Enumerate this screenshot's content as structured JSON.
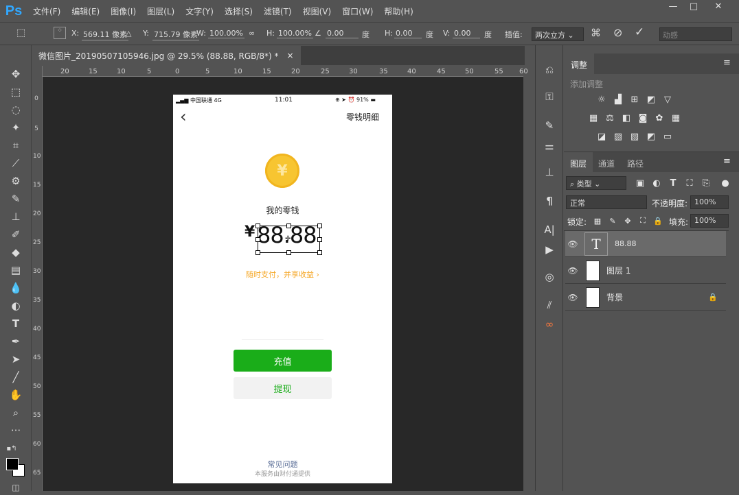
{
  "app": {
    "logo": "Ps"
  },
  "menu": [
    "文件(F)",
    "编辑(E)",
    "图像(I)",
    "图层(L)",
    "文字(Y)",
    "选择(S)",
    "滤镜(T)",
    "视图(V)",
    "窗口(W)",
    "帮助(H)"
  ],
  "window_controls": {
    "minimize": "—",
    "maximize": "□",
    "close": "✕"
  },
  "options": {
    "x_label": "X:",
    "x_value": "569.11 像素",
    "y_label": "Y:",
    "y_value": "715.79 像素",
    "w_label": "W:",
    "w_value": "100.00%",
    "h_label": "H:",
    "h_value": "100.00%",
    "angle_value": "0.00",
    "angle_unit": "度",
    "h_skew_label": "H:",
    "h_skew_value": "0.00",
    "h_skew_unit": "度",
    "v_skew_label": "V:",
    "v_skew_value": "0.00",
    "v_skew_unit": "度",
    "interp_label": "插值:",
    "interp_value": "两次立方",
    "warp_label": "动感"
  },
  "document_tab": {
    "title": "微信图片_20190507105946.jpg @ 29.5% (88.88, RGB/8*) *",
    "close": "×"
  },
  "hruler": [
    "20",
    "15",
    "10",
    "5",
    "0",
    "5",
    "10",
    "15",
    "20",
    "25",
    "30",
    "35",
    "40",
    "45",
    "50",
    "55",
    "60"
  ],
  "vruler": [
    "0",
    "5",
    "10",
    "15",
    "20",
    "25",
    "30",
    "35",
    "40",
    "45",
    "50",
    "55",
    "60",
    "65"
  ],
  "phone": {
    "carrier": "中国联通",
    "network": "4G",
    "time": "11:01",
    "battery": "91%",
    "back": "‹",
    "header_link": "零钱明细",
    "coin_symbol": "¥",
    "balance_label": "我的零钱",
    "currency": "¥",
    "amount": "88.88",
    "promo": "随时支付，并享收益 ›",
    "recharge_label": "充值",
    "withdraw_label": "提现",
    "faq": "常见问题",
    "footer": "本服务由财付通提供"
  },
  "panels": {
    "adjust_tab": "调整",
    "adjust_add": "添加调整",
    "tabs": [
      "图层",
      "通道",
      "路径"
    ],
    "filter_kind": "类型",
    "blend_mode": "正常",
    "opacity_label": "不透明度:",
    "opacity_value": "100%",
    "lock_label": "锁定:",
    "fill_label": "填充:",
    "fill_value": "100%",
    "layers": [
      {
        "name": "88.88",
        "type": "text"
      },
      {
        "name": "图层 1",
        "type": "image"
      },
      {
        "name": "背景",
        "type": "image",
        "locked": true
      }
    ]
  },
  "colors": {
    "accent": "#31a8ff",
    "wechat_green": "#1aad19",
    "coin": "#f7c531",
    "promo": "#f5a623"
  }
}
